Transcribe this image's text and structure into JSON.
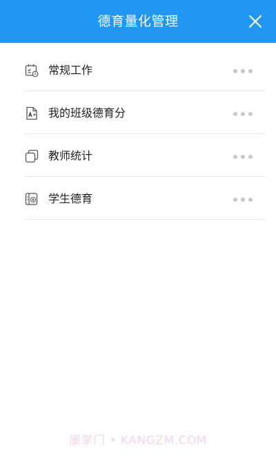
{
  "header": {
    "title": "德育量化管理",
    "close_icon": "close-icon",
    "background_color": "#2196f3"
  },
  "menu": {
    "items": [
      {
        "label": "常规工作",
        "icon": "calendar-clock-icon"
      },
      {
        "label": "我的班级德育分",
        "icon": "grade-a-plus-icon"
      },
      {
        "label": "教师统计",
        "icon": "stacked-copy-icon"
      },
      {
        "label": "学生德育",
        "icon": "ledger-icon"
      }
    ],
    "more_icon": "more-dots-icon"
  },
  "watermark": {
    "text": "康掌门 • KANGZM.COM",
    "color": "#f3d6ea"
  }
}
